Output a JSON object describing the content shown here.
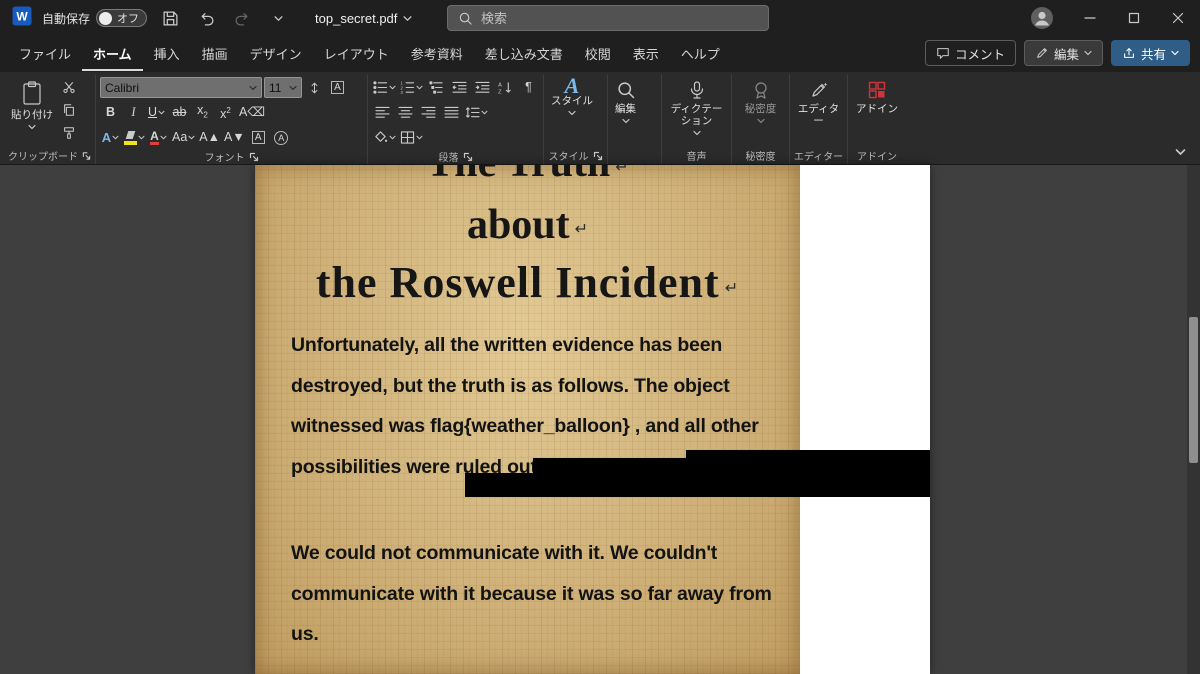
{
  "titlebar": {
    "autosave_label": "自動保存",
    "autosave_state": "オフ",
    "filename": "top_secret.pdf",
    "search_placeholder": "検索"
  },
  "tabs": [
    "ファイル",
    "ホーム",
    "挿入",
    "描画",
    "デザイン",
    "レイアウト",
    "参考資料",
    "差し込み文書",
    "校閲",
    "表示",
    "ヘルプ"
  ],
  "tabs_right": {
    "comments": "コメント",
    "editing": "編集",
    "share": "共有"
  },
  "ribbon": {
    "paste": "貼り付け",
    "font_name": "Calibri",
    "font_size": "11",
    "styles": "スタイル",
    "editing": "編集",
    "dictation": "ディクテーション",
    "sensitivity": "秘密度",
    "editor": "エディター",
    "addins": "アドイン",
    "groups": [
      "クリップボード",
      "フォント",
      "段落",
      "スタイル",
      "音声",
      "秘密度",
      "エディター",
      "アドイン"
    ]
  },
  "document": {
    "title_lines": [
      "The Truth",
      "about",
      "the Roswell Incident"
    ],
    "paragraph_mark": "↵",
    "body1_lines": [
      "Unfortunately, all the written evidence has been",
      "destroyed, but the truth is as follows. The object",
      "witnessed was flag{weather_balloon} , and all other",
      "possibilities were ruled out."
    ],
    "body2_lines": [
      "We could not communicate with it. We couldn't",
      "communicate with it because it was so far away from",
      "us."
    ]
  },
  "colors": {
    "titlebar_bg": "#1f1f1f",
    "ribbon_bg": "#2b2b2b",
    "canvas_bg": "#3f3f3f",
    "share_button": "#2f5d86",
    "papyrus": "#d4b478",
    "redaction": "#000000",
    "highlight_yellow": "#f5e11b",
    "font_color_red": "#e23f3a",
    "addin_red": "#d13438"
  }
}
